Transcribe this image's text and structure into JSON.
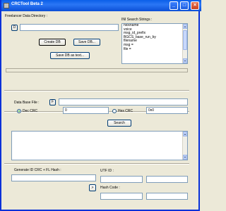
{
  "window": {
    "title": "CRCTool Beta 2",
    "min": "_",
    "max": "□",
    "close": "×"
  },
  "freelancer": {
    "label": "Freelancer Data Directory :",
    "browse": "D",
    "path": ""
  },
  "buttons": {
    "create_db": "Create DB",
    "save_db": "Save DB...",
    "save_db_text": "Save DB as text..."
  },
  "ini": {
    "label": "INI Search Strings :",
    "items": [
      "nickname",
      "voice",
      "msg_id_prefix",
      "BGCS_base_run_by",
      "filename",
      "msg =",
      "file ="
    ]
  },
  "database": {
    "label": "Data Base File :",
    "browse": "F",
    "path": ""
  },
  "crc": {
    "dec_label": "Dec CRC",
    "dec_value": "0",
    "hex_label": "Hex CRC",
    "hex_value": "0x0",
    "search": "Search"
  },
  "generate": {
    "label": "Generate ID CRC + FL Hash :",
    "input": "",
    "go": ">"
  },
  "utf": {
    "label": "UTF ID :",
    "value": ""
  },
  "hash": {
    "label": "Hash Code :",
    "value": ""
  }
}
